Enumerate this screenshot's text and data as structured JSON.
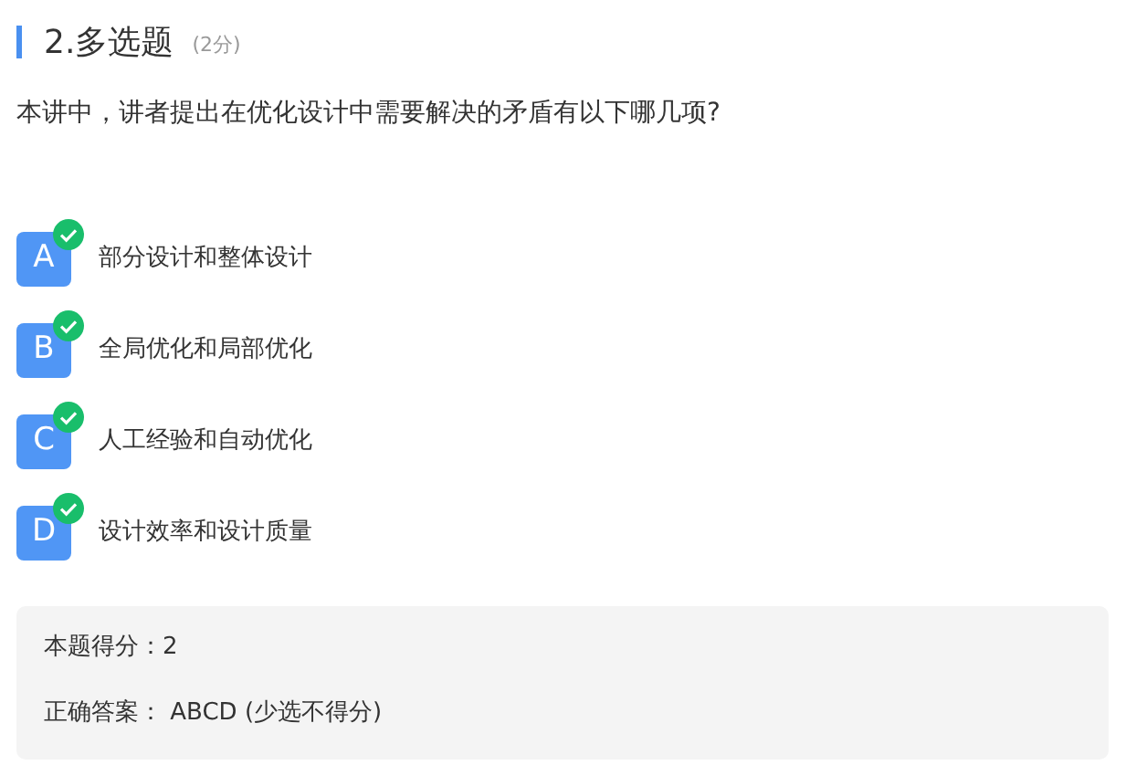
{
  "question": {
    "number_title": "2.多选题",
    "points": "(2分)",
    "text": "本讲中，讲者提出在优化设计中需要解决的矛盾有以下哪几项?"
  },
  "options": [
    {
      "letter": "A",
      "text": "部分设计和整体设计",
      "checked": true
    },
    {
      "letter": "B",
      "text": "全局优化和局部优化",
      "checked": true
    },
    {
      "letter": "C",
      "text": "人工经验和自动优化",
      "checked": true
    },
    {
      "letter": "D",
      "text": "设计效率和设计质量",
      "checked": true
    }
  ],
  "result": {
    "score_label": "本题得分：",
    "score": "2",
    "answer_label": "正确答案：",
    "answer": "ABCD (少选不得分)"
  }
}
